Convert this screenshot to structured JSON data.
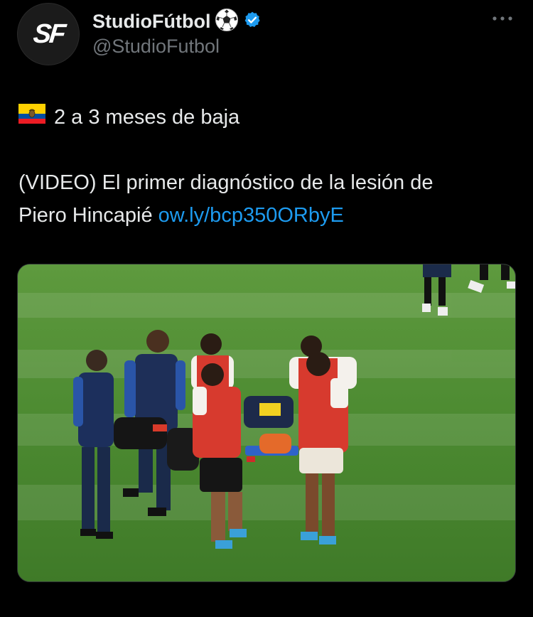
{
  "author": {
    "avatar_text": "SF",
    "display_name": "StudioFútbol",
    "handle": "@StudioFutbol",
    "verified": true,
    "badge_icon": "soccer-ball-icon",
    "verified_icon": "verified-badge-icon"
  },
  "post": {
    "flag_icon": "ecuador-flag-icon",
    "line1": "2 a 3 meses de baja",
    "line2": "(VIDEO) El primer diagnóstico de la lesión de",
    "line3_text": "Piero Hincapié ",
    "link": "ow.ly/bcp350ORbyE"
  },
  "media": {
    "type": "photo",
    "subject": "injured player carried off on stretcher by medical staff"
  },
  "colors": {
    "background": "#000000",
    "text": "#e7e9ea",
    "secondary": "#71767b",
    "link": "#1d9bf0",
    "verified": "#1d9bf0",
    "pitch": "#4d8a33"
  }
}
